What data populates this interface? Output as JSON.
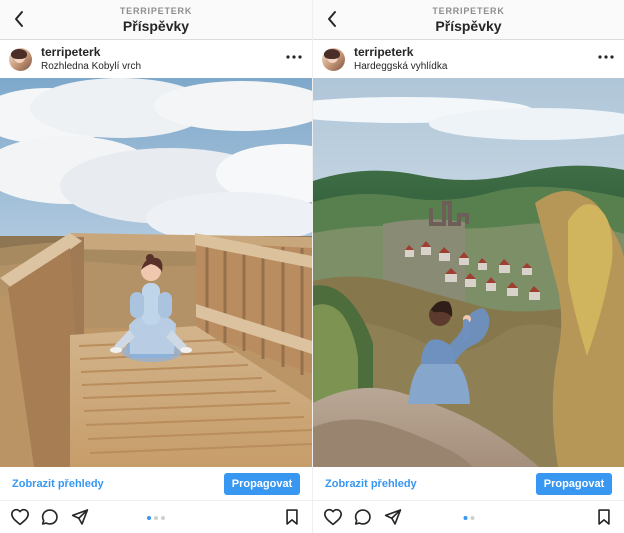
{
  "posts": [
    {
      "header_username": "TERRIPETERK",
      "header_title": "Příspěvky",
      "username": "terripeterk",
      "location": "Rozhledna Kobylí vrch",
      "insights_label": "Zobrazit přehledy",
      "promote_label": "Propagovat",
      "carousel_position": 1,
      "carousel_total": 3
    },
    {
      "header_username": "TERRIPETERK",
      "header_title": "Příspěvky",
      "username": "terripeterk",
      "location": "Hardeggská vyhlídka",
      "insights_label": "Zobrazit přehledy",
      "promote_label": "Propagovat",
      "carousel_position": 1,
      "carousel_total": 2
    }
  ],
  "icons": {
    "back": "chevron-left-icon",
    "more": "ellipsis-horizontal-icon",
    "like": "heart-icon",
    "comment": "comment-icon",
    "share": "send-icon",
    "save": "bookmark-icon"
  },
  "colors": {
    "accent": "#3897f0",
    "text": "#262626",
    "muted": "#8e8e8e",
    "divider": "#dbdbdb"
  }
}
